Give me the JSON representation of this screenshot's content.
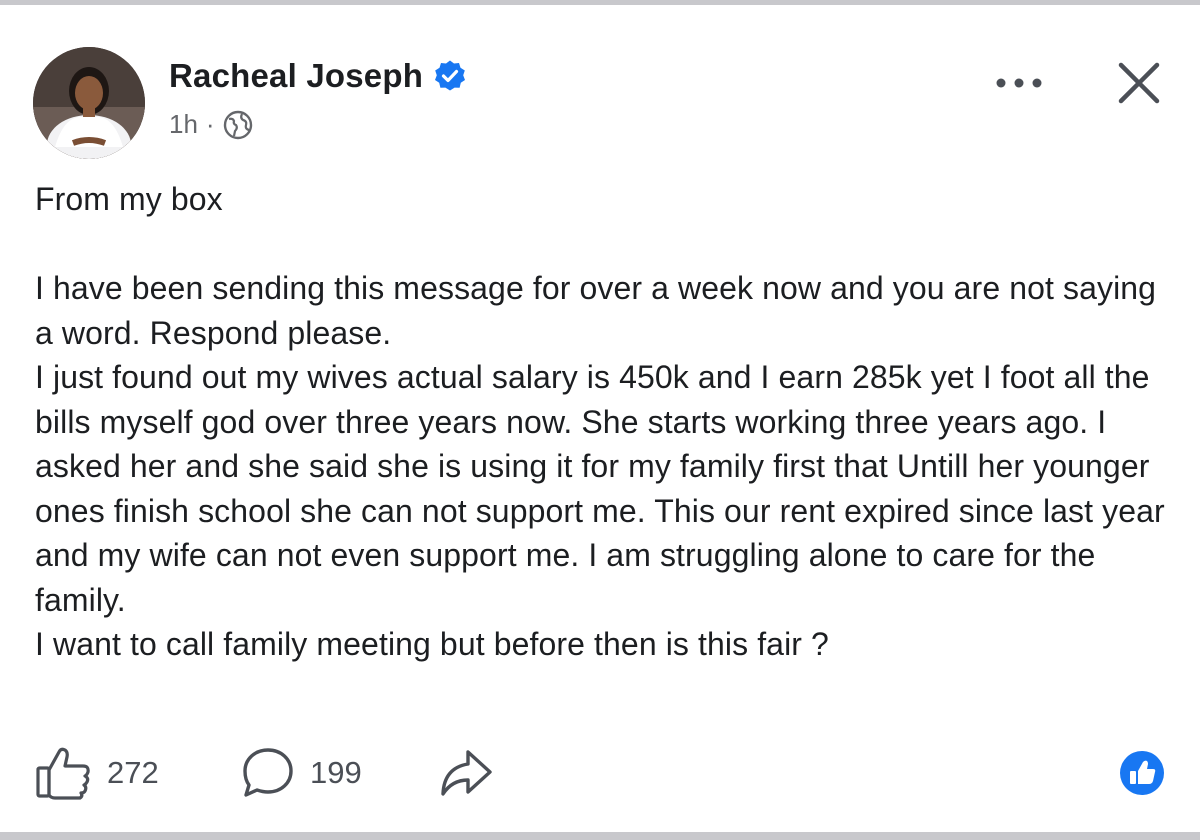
{
  "post": {
    "author": "Racheal Joseph",
    "verified": true,
    "timestamp": "1h",
    "separator": "·",
    "audience_icon": "globe-icon",
    "intro": "From my box",
    "paragraphs": [
      "I have been sending this message for over a week now and you are not saying a word. Respond please.",
      "I just found out my wives actual salary is 450k and I earn 285k yet I foot all the bills myself god over three years now. She starts working three years ago. I asked her and she said she is using it for my family first that Untill her younger ones finish school she can not support me. This our rent expired since last year and my wife can not even support me. I am struggling alone to care for the family.",
      "I want to call family meeting but before then is this fair ?"
    ]
  },
  "actions": {
    "likes": "272",
    "comments": "199"
  },
  "icons": {
    "more": "more-dots-icon",
    "close": "close-icon",
    "like": "thumbs-up-icon",
    "comment": "comment-bubble-icon",
    "share": "share-arrow-icon",
    "reaction": "like-reaction-icon",
    "verified": "verified-badge-icon"
  },
  "colors": {
    "verified_blue": "#1877f2",
    "text": "#1c1e21",
    "secondary_text": "#65676b",
    "frame_border": "#c8c8cc"
  }
}
